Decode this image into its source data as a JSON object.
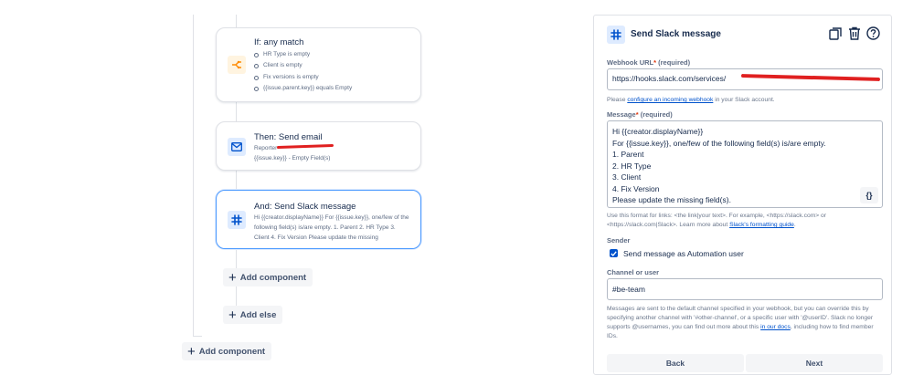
{
  "workflow": {
    "if_card": {
      "title": "If: any match",
      "conditions": [
        "HR Type is empty",
        "Client is empty",
        "Fix versions is empty",
        "{{issue.parent.key}} equals Empty"
      ]
    },
    "then_card": {
      "title": "Then: Send email",
      "line1": "Reporter",
      "line2": "{{issue.key}} - Empty Field(s)"
    },
    "and_card": {
      "title": "And: Send Slack message",
      "body": "Hi {{creator.displayName}} For {{issue.key}}, one/few of the following field(s) is/are empty. 1. Parent 2. HR Type 3. Client 4. Fix Version Please update the missing"
    },
    "add_component_label": "Add component",
    "add_else_label": "Add else",
    "add_component_outer_label": "Add component"
  },
  "panel": {
    "title": "Send Slack message",
    "webhook": {
      "label": "Webhook URL",
      "required_marker": "*",
      "required_text": "(required)",
      "value": "https://hooks.slack.com/services/",
      "hint_prefix": "Please ",
      "hint_link": "configure an incoming webhook",
      "hint_suffix": " in your Slack account."
    },
    "message": {
      "label": "Message",
      "required_marker": "*",
      "required_text": "(required)",
      "lines": [
        "Hi {{creator.displayName}}",
        "For {{issue.key}}, one/few of the following field(s) is/are empty.",
        "1. Parent",
        "2. HR Type",
        "3. Client",
        "4. Fix Version",
        "Please update the missing field(s)."
      ],
      "smart_value_button": "{}",
      "hint": "Use this format for links: <the link|your text>. For example, <https://slack.com> or <https://slack.com|Slack>. Learn more about ",
      "hint_link": "Slack's formatting guide",
      "hint_suffix": "."
    },
    "sender": {
      "label": "Sender",
      "checkbox_label": "Send message as Automation user",
      "checked": true
    },
    "channel": {
      "label": "Channel or user",
      "value": "#be-team",
      "hint": "Messages are sent to the default channel specified in your webhook, but you can override this by specifying another channel with '#other-channel', or a specific user with '@userID'. Slack no longer supports @usernames, you can find out more about this ",
      "hint_link": "in our docs",
      "hint_suffix": ", including how to find member IDs."
    },
    "back_label": "Back",
    "next_label": "Next"
  },
  "colors": {
    "accent": "#0052cc",
    "selected_border": "#4c9aff",
    "redaction": "#e02020",
    "condition_icon_bg": "#fff4e0",
    "condition_icon": "#ff8b00",
    "action_icon_bg": "#deebff",
    "action_icon": "#0052cc"
  }
}
